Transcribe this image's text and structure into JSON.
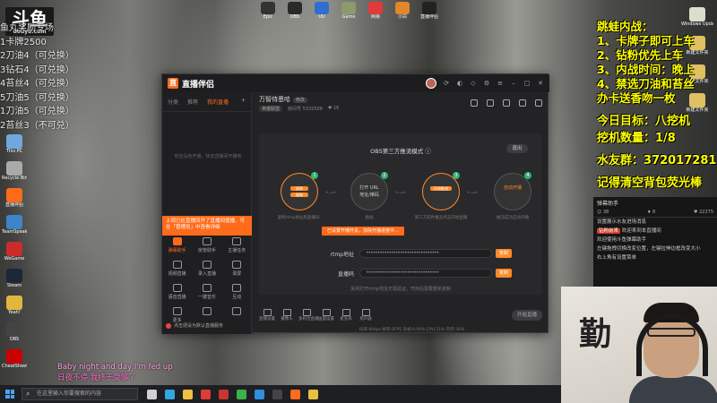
{
  "stream_logo": {
    "main": "斗鱼",
    "sub": "douyu.com"
  },
  "left_overlay": [
    "鱼丸奖励专场",
    "1卡牌2500",
    "2刀油4（可兑换）",
    "3钻石4（可兑换）",
    "4苔丝4（可兑换）",
    "5刀油5（可兑换）",
    "1刀油5（可兑换）",
    "2苔丝3（不可兑）"
  ],
  "desktop_left_icons": [
    {
      "label": "This PC",
      "color": "#6fa8dc"
    },
    {
      "label": "Recycle Bin",
      "color": "#aaaaaa"
    },
    {
      "label": "直播伴侣",
      "color": "#ff6b1a"
    },
    {
      "label": "TeamSpeak",
      "color": "#3d85c6"
    },
    {
      "label": "WeGame",
      "color": "#cc2b2b"
    },
    {
      "label": "Steam",
      "color": "#1b2838"
    },
    {
      "label": "Yeah!",
      "color": "#e0b73a"
    },
    {
      "label": "OBS",
      "color": "#444444"
    },
    {
      "label": "CheatSheet",
      "color": "#cc0000"
    }
  ],
  "desktop_top_icons": [
    {
      "label": "Epic",
      "color": "#333333"
    },
    {
      "label": "OBS",
      "color": "#2a2a2a"
    },
    {
      "label": "UU",
      "color": "#2f6fd1"
    },
    {
      "label": "Game",
      "color": "#8b9b6e"
    },
    {
      "label": "网易",
      "color": "#e03a3a"
    },
    {
      "label": "小白",
      "color": "#e0862b"
    },
    {
      "label": "直播伴侣",
      "color": "#222222"
    }
  ],
  "desktop_right_icons": [
    {
      "label": "Windows Update",
      "color": "#ddddcc"
    },
    {
      "label": "新建文件夹",
      "color": "#e0c060"
    },
    {
      "label": "新建文件夹",
      "color": "#e0c060"
    },
    {
      "label": "新建文件夹",
      "color": "#e0c060"
    }
  ],
  "right_overlay": {
    "lines": [
      "跳蛙内战：",
      "1、卡牌子即可上车",
      "2、钻粉优先上车",
      "3、内战时间：晚上",
      "4、禁选刀油和苔丝",
      "办卡送香吻一枚"
    ],
    "goal": "今日目标：八挖机",
    "count": "挖机数量：1/8",
    "qq": "水友群：372017281",
    "reminder": "记得清空背包荧光棒"
  },
  "chat": {
    "title": "弹幕助手",
    "stats": [
      "38",
      "8",
      "22275"
    ],
    "messages": [
      {
        "tag": "",
        "text": "设置展示水友进场消息"
      },
      {
        "tag": "钻粉前来",
        "text": "欢迎来到本直播间"
      },
      {
        "tag": "",
        "text": "欢迎使用斗鱼弹幕助手"
      },
      {
        "tag": "",
        "text": "左键拖拽切换改变位置，左键拉伸边框改变大小"
      },
      {
        "tag": "",
        "text": "右上角有设置菜单"
      }
    ]
  },
  "subtitles": [
    "Baby night and day I'm fed up",
    "日夜不停 我终于受够了"
  ],
  "app": {
    "name": "直播伴侣",
    "sidebar_tabs": [
      "分类",
      "推荐",
      "我的直播"
    ],
    "sidebar_note": "你还没有开播，快去直播间开播吧",
    "alert": "上周已在直播间开了直播间值播、可在「管理员」中查看详细",
    "tools": [
      [
        {
          "label": "弹幕助手",
          "active": true
        },
        {
          "label": "房管助手",
          "active": false
        },
        {
          "label": "主播任务",
          "active": false
        }
      ],
      [
        {
          "label": "视频直播",
          "active": false
        },
        {
          "label": "录入直播",
          "active": false
        },
        {
          "label": "录屏",
          "active": false
        }
      ],
      [
        {
          "label": "语音直播",
          "active": false
        },
        {
          "label": "一键音乐",
          "active": false
        },
        {
          "label": "互动",
          "active": false
        }
      ],
      [
        {
          "label": "更多",
          "active": false
        },
        {
          "label": "",
          "active": false
        },
        {
          "label": "",
          "active": false
        }
      ]
    ],
    "sidebar_footer": "点击把设为默认直播服务",
    "room_title": "万智侍恩哈",
    "room_badge": "修改",
    "room_category": "英雄联盟",
    "room_id_label": "房间号",
    "room_id": "5332508",
    "fans_label": "16",
    "obs_title": "OBS第三方推流模式",
    "exit_label": "退出",
    "steps": [
      {
        "num": "1",
        "lines": [
          "复制",
          "复制"
        ],
        "caption": "复制rtmp地址和直播码"
      },
      {
        "num": "2",
        "lines": [
          "打开 URL",
          "地址/推码"
        ],
        "caption": "粘贴"
      },
      {
        "num": "3",
        "lines": [
          "开始推流"
        ],
        "caption": "第三方软件推流点击开始直播"
      },
      {
        "num": "4",
        "lines": [
          "自动开播"
        ],
        "caption": "推流成功自动开播"
      }
    ],
    "help_bubble": "已设置开播开关，加快开播进度中…",
    "rtmp_label": "rtmp地址",
    "rtmp_value": "••••••••••••••••••••••••••••••••",
    "key_label": "直播码",
    "key_value": "••••••••••••••••••••••••••••••••",
    "copy_label": "复制",
    "obs_note": "关闭打开rtmp地址无需验证，开启后需要重新复制",
    "bottom_tools": [
      "直播设置",
      "摄像头",
      "多机位直播",
      "画面设置",
      "麦克风",
      "扬声器"
    ],
    "start_label": "开始直播",
    "status": "码率:0kbps  帧率:0FPS  丢帧:0.00%  CPU:11%  内存:30%"
  },
  "taskbar": {
    "search_placeholder": "在这里输入你要搜索的内容",
    "icons": [
      {
        "name": "task-view",
        "color": "#cfcfcf"
      },
      {
        "name": "edge",
        "color": "#2fa8e0"
      },
      {
        "name": "explorer",
        "color": "#f0c040"
      },
      {
        "name": "netease",
        "color": "#e03a3a"
      },
      {
        "name": "app",
        "color": "#cc3333"
      },
      {
        "name": "wechat",
        "color": "#3cb04b"
      },
      {
        "name": "qq",
        "color": "#2f8fe0"
      },
      {
        "name": "obs",
        "color": "#444444"
      },
      {
        "name": "douyu",
        "color": "#ff6b1a"
      },
      {
        "name": "chrome",
        "color": "#e8c040"
      }
    ]
  }
}
